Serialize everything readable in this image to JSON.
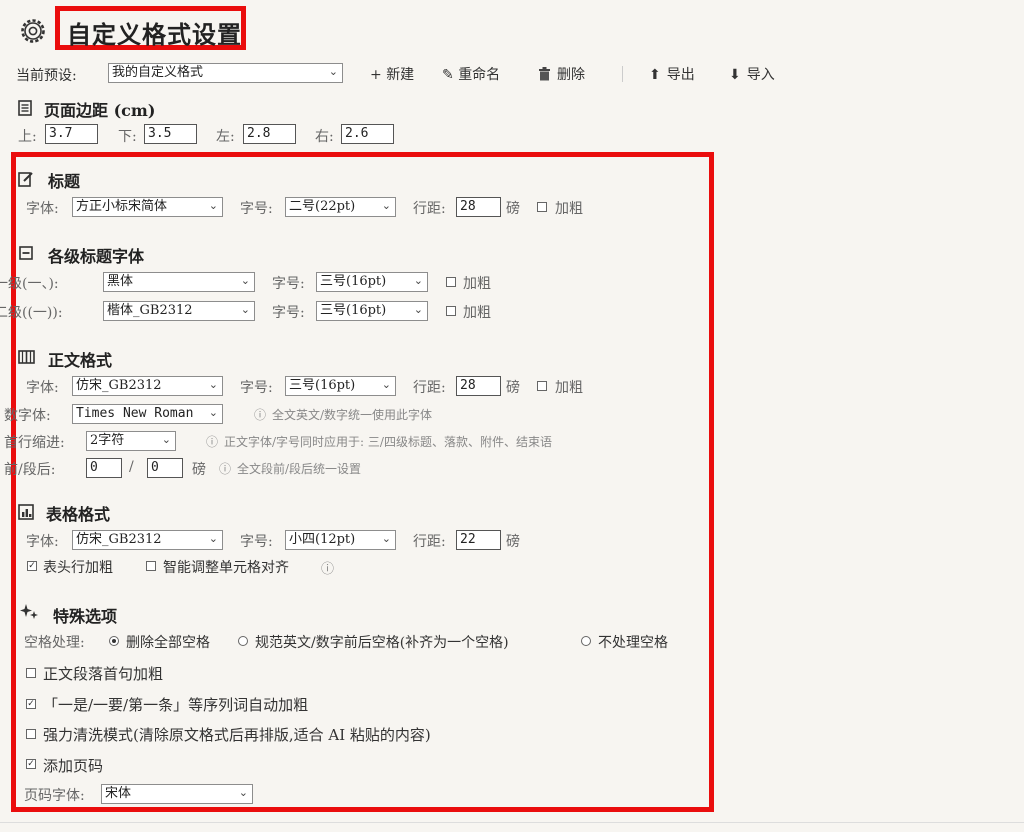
{
  "header": {
    "title": "自定义格式设置",
    "icon": "gear-icon"
  },
  "toolbar": {
    "preset_label": "当前预设:",
    "preset_value": "我的自定义格式",
    "new_label": "新建",
    "rename_label": "重命名",
    "delete_label": "删除",
    "export_label": "导出",
    "import_label": "导入"
  },
  "margins": {
    "title": "页面边距 (cm)",
    "top_label": "上:",
    "top_value": "3.7",
    "bottom_label": "下:",
    "bottom_value": "3.5",
    "left_label": "左:",
    "left_value": "2.8",
    "right_label": "右:",
    "right_value": "2.6"
  },
  "title_section": {
    "title": "标题",
    "font_label": "字体:",
    "font_value": "方正小标宋简体",
    "size_label": "字号:",
    "size_value": "二号(22pt)",
    "spacing_label": "行距:",
    "spacing_value": "28",
    "unit": "磅",
    "bold_label": "加粗",
    "bold_checked": false
  },
  "heading_fonts": {
    "title": "各级标题字体",
    "level1_label": "一级(一、):",
    "level1_font": "黑体",
    "level1_size_label": "字号:",
    "level1_size": "三号(16pt)",
    "level1_bold_label": "加粗",
    "level1_bold": false,
    "level2_label": "二级((一)):",
    "level2_font": "楷体_GB2312",
    "level2_size_label": "字号:",
    "level2_size": "三号(16pt)",
    "level2_bold_label": "加粗",
    "level2_bold": false
  },
  "body_format": {
    "title": "正文格式",
    "font_label": "字体:",
    "font_value": "仿宋_GB2312",
    "size_label": "字号:",
    "size_value": "三号(16pt)",
    "spacing_label": "行距:",
    "spacing_value": "28",
    "unit": "磅",
    "bold_label": "加粗",
    "bold_checked": false,
    "num_font_label": "数字体:",
    "num_font_value": "Times New Roman",
    "num_font_hint": "全文英文/数字统一使用此字体",
    "indent_label": "首行缩进:",
    "indent_value": "2字符",
    "indent_hint": "正文字体/字号同时应用于: 三/四级标题、落款、附件、结束语",
    "para_label": "前/段后:",
    "para_before": "0",
    "para_sep": "/",
    "para_after": "0",
    "para_unit": "磅",
    "para_hint": "全文段前/段后统一设置"
  },
  "table_format": {
    "title": "表格格式",
    "font_label": "字体:",
    "font_value": "仿宋_GB2312",
    "size_label": "字号:",
    "size_value": "小四(12pt)",
    "spacing_label": "行距:",
    "spacing_value": "22",
    "unit": "磅",
    "header_bold_label": "表头行加粗",
    "header_bold": true,
    "smart_align_label": "智能调整单元格对齐",
    "smart_align": false
  },
  "special_options": {
    "title": "特殊选项",
    "space_label": "空格处理:",
    "space_opt1": "删除全部空格",
    "space_opt2": "规范英文/数字前后空格(补齐为一个空格)",
    "space_opt3": "不处理空格",
    "space_selected": 1,
    "first_sentence_bold_label": "正文段落首句加粗",
    "first_sentence_bold": false,
    "ordinal_bold_label": "「一是/一要/第一条」等序列词自动加粗",
    "ordinal_bold": true,
    "force_clean_label": "强力清洗模式(清除原文格式后再排版,适合 AI 粘贴的内容)",
    "force_clean": false,
    "page_number_label": "添加页码",
    "page_number": true,
    "page_font_label": "页码字体:",
    "page_font_value": "宋体"
  },
  "glyphs": {
    "check": "✓",
    "arrow": "⌄",
    "info": "ⓘ"
  }
}
